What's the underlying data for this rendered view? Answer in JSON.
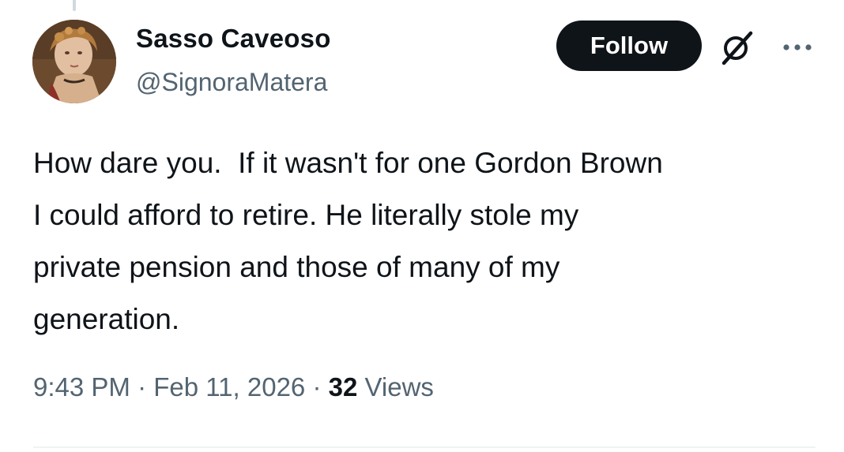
{
  "author": {
    "display_name": "Sasso Caveoso",
    "handle": "@SignoraMatera"
  },
  "actions": {
    "follow_label": "Follow",
    "grok_icon": "grok-slash-circle-icon",
    "more_icon": "more-dots-icon"
  },
  "tweet": {
    "text": "How dare you.  If it wasn't for one Gordon Brown\nI could afford to retire. He literally stole my\nprivate pension and those of many of my\ngeneration."
  },
  "meta": {
    "time": "9:43 PM",
    "separator": " · ",
    "date": "Feb 11, 2026",
    "views_count": "32",
    "views_label": " Views"
  },
  "colors": {
    "text_primary": "#0f1419",
    "text_secondary": "#536471",
    "follow_bg": "#0f1419",
    "divider": "#eff3f4"
  }
}
